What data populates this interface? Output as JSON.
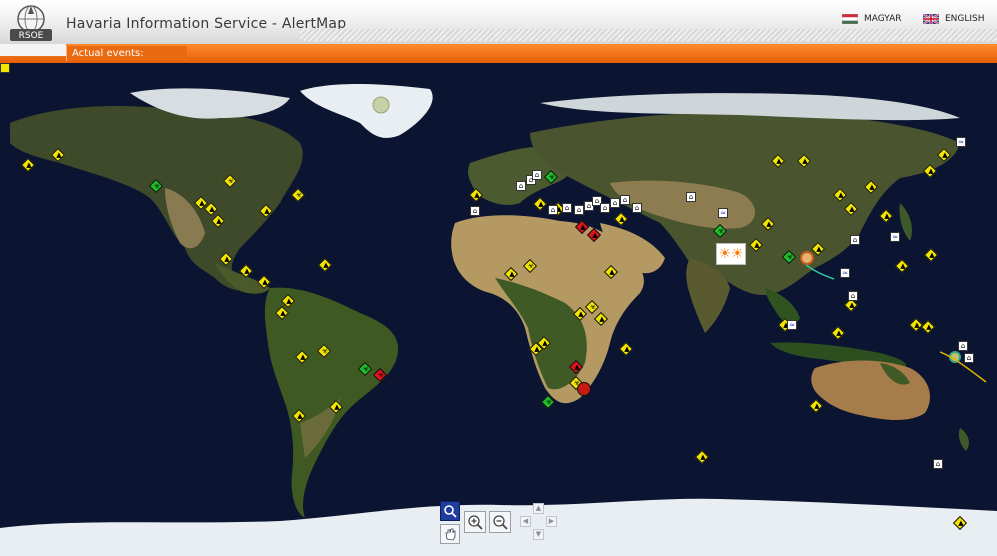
{
  "header": {
    "logo_text": "RSOE",
    "title": "Havaria Information Service - AlertMap",
    "languages": [
      {
        "label": "MAGYAR",
        "flag": "hungary-flag-icon"
      },
      {
        "label": "ENGLISH",
        "flag": "uk-flag-icon"
      }
    ]
  },
  "events_bar": {
    "label": "Actual events:"
  },
  "colors": {
    "accent_orange": "#ee6f16",
    "ocean": "#0b1430",
    "marker_yellow": "#f2e600",
    "marker_green": "#1fbf2a",
    "marker_red": "#e0121a"
  },
  "map_controls": {
    "icons": [
      "zoom-select-icon",
      "pan-hand-icon",
      "zoom-in-icon",
      "zoom-out-icon",
      "pan-up-icon",
      "pan-left-icon",
      "pan-right-icon",
      "pan-down-icon"
    ]
  }
}
